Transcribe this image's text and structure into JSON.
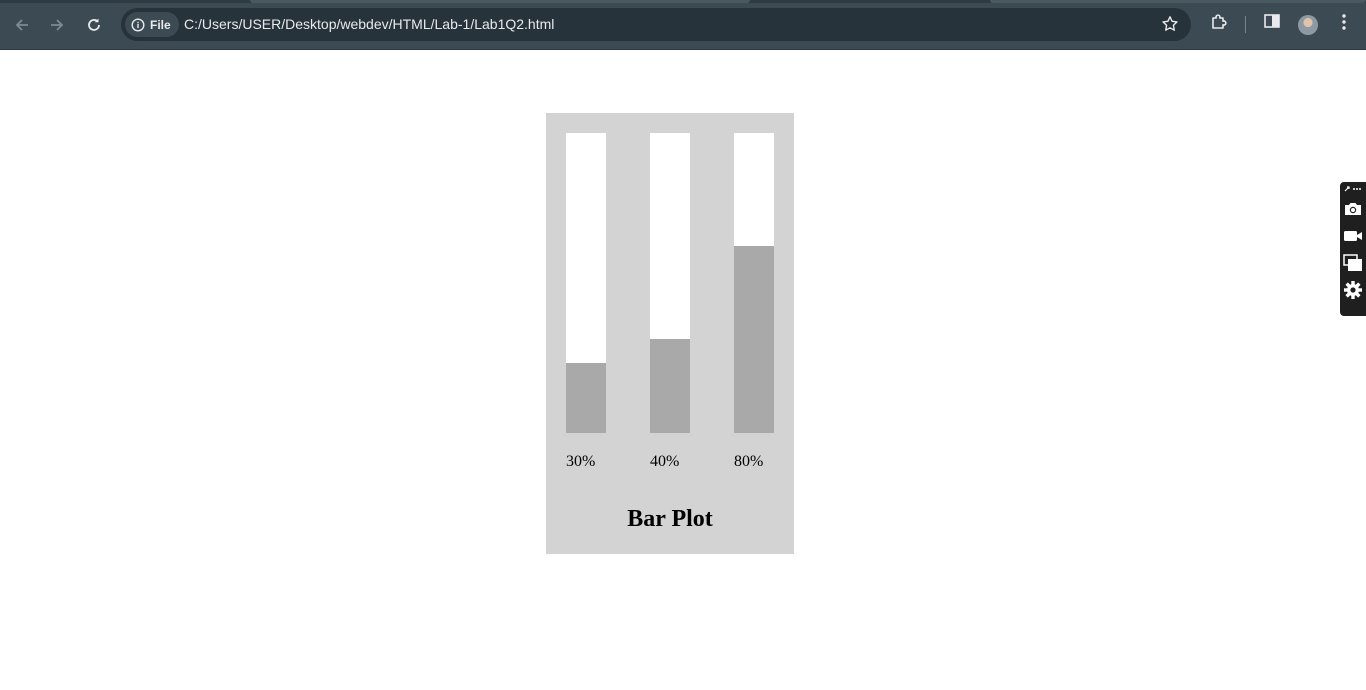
{
  "browser": {
    "site_chip_label": "File",
    "url": "C:/Users/USER/Desktop/webdev/HTML/Lab-1/Lab1Q2.html"
  },
  "chart_data": {
    "type": "bar",
    "title": "Bar Plot",
    "categories": [
      "30%",
      "40%",
      "80%"
    ],
    "values": [
      30,
      40,
      80
    ],
    "ylim": [
      0,
      100
    ],
    "colors": {
      "background": "#d3d3d3",
      "track": "#ffffff",
      "fill": "#a9a9a9"
    }
  }
}
